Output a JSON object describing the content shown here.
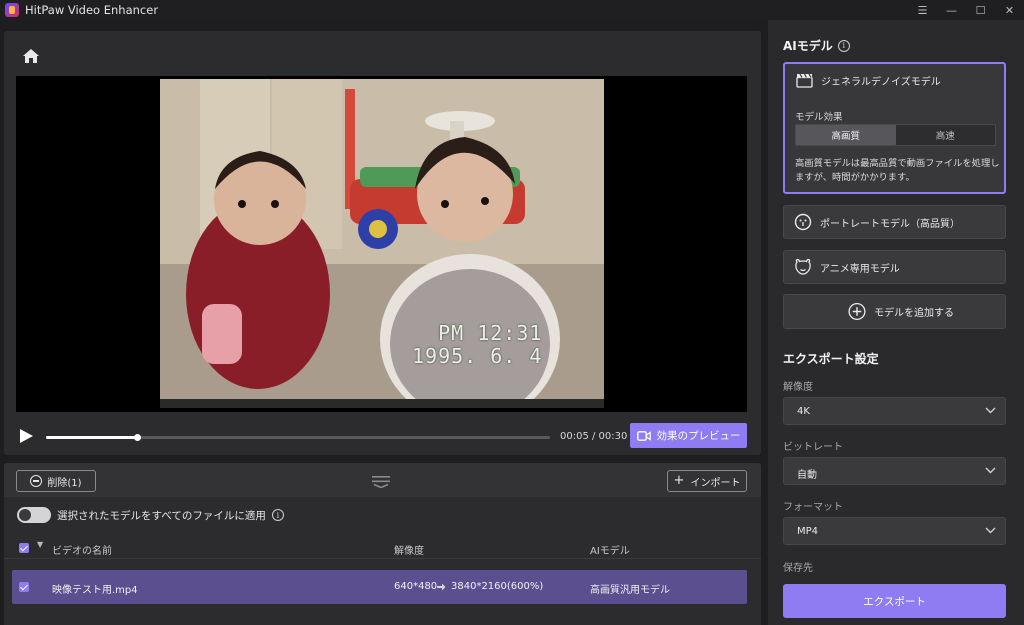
{
  "window": {
    "title": "HitPaw Video Enhancer",
    "controls": [
      "☰",
      "—",
      "☐",
      "✕"
    ]
  },
  "player": {
    "video_overlay_time": "PM 12:31",
    "video_overlay_date": "1995. 6. 4",
    "time_display": "00:05 / 00:30",
    "progress_fraction": 0.18,
    "preview_label": "効果のプレビュー"
  },
  "file_list": {
    "delete_label": "削除(1)",
    "import_label": "インポート",
    "apply_all_label": "選択されたモデルをすべてのファイルに適用",
    "columns": {
      "name": "ビデオの名前",
      "resolution": "解像度",
      "model": "AIモデル"
    },
    "rows": [
      {
        "name": "映像テスト用.mp4",
        "res_from": "640*480",
        "res_to": "3840*2160(600%)",
        "model": "高画質汎用モデル"
      }
    ]
  },
  "side": {
    "ai_model_title": "AIモデル",
    "models": {
      "general": "ジェネラルデノイズモデル",
      "effect_label": "モデル効果",
      "effect_options": [
        "高画質",
        "高速"
      ],
      "description": "高画質モデルは最高品質で動画ファイルを処理しますが、時間がかかります。",
      "portrait": "ポートレートモデル（高品質）",
      "anime": "アニメ専用モデル",
      "add": "モデルを追加する"
    },
    "export_title": "エクスポート設定",
    "resolution_label": "解像度",
    "resolution_value": "4K",
    "bitrate_label": "ビットレート",
    "bitrate_value": "自動",
    "format_label": "フォーマット",
    "format_value": "MP4",
    "save_label": "保存先",
    "export_button": "エクスポート"
  },
  "colors": {
    "accent": "#8f7cf2",
    "selected_row": "#5b4f8f",
    "panel": "#2c2c2e"
  }
}
